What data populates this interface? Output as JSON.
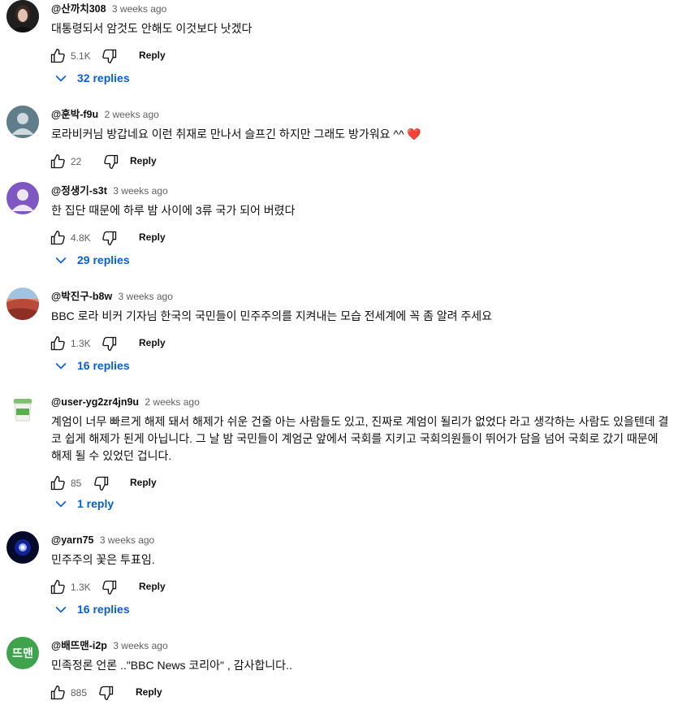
{
  "comments": [
    {
      "author": "@산까치308",
      "time": "3 weeks ago",
      "text": "대통령되서 암것도 안해도 이것보다 낫겠다",
      "likes": "5.1K",
      "reply_label": "Reply",
      "replies_label": "32 replies",
      "avatar": "photo-dark"
    },
    {
      "author": "@훈박-f9u",
      "time": "2 weeks ago",
      "text": "로라비커님 방갑네요 이런 취재로 만나서 슬프긴 하지만 그래도 방가워요 ^^ ❤️",
      "likes": "22",
      "reply_label": "Reply",
      "avatar": "default-gray"
    },
    {
      "author": "@정생기-s3t",
      "time": "3 weeks ago",
      "text": "한 집단 때문에 하루 밤 사이에 3류 국가 되어 버렸다",
      "likes": "4.8K",
      "reply_label": "Reply",
      "replies_label": "29 replies",
      "avatar": "default-purple"
    },
    {
      "author": "@박진구-b8w",
      "time": "3 weeks ago",
      "text": "BBC 로라 비커 기자님 한국의 국민들이 민주주의를 지켜내는 모습 전세계에 꼭 좀 알려 주세요",
      "likes": "1.3K",
      "reply_label": "Reply",
      "replies_label": "16 replies",
      "avatar": "landscape"
    },
    {
      "author": "@user-yg2zr4jn9u",
      "time": "2 weeks ago",
      "text": "계엄이 너무 빠르게 해제 돼서 해제가 쉬운 건줄 아는 사람들도 있고, 진짜로 계엄이 될리가 없었다 라고 생각하는 사람도 있을텐데 결코 쉽게 해제가 된게 아닙니다. 그 날 밤 국민들이 계엄군 앞에서 국회를 지키고 국회의원들이 뛰어가 담을 넘어 국회로 갔기 때문에 해제 될 수 있었던 겁니다.",
      "likes": "85",
      "reply_label": "Reply",
      "replies_label": "1 reply",
      "avatar": "yogurt-cup"
    },
    {
      "author": "@yarn75",
      "time": "3 weeks ago",
      "text": "민주주의 꽃은 투표임.",
      "likes": "1.3K",
      "reply_label": "Reply",
      "replies_label": "16 replies",
      "avatar": "blue-star"
    },
    {
      "author": "@배뜨맨-i2p",
      "time": "3 weeks ago",
      "text": "민족정론 언론 ..\"BBC News 코리아\" , 감사합니다..",
      "likes": "885",
      "reply_label": "Reply",
      "avatar": "text-badge",
      "avatar_text": "뜨맨"
    }
  ],
  "colors": {
    "link_blue": "#065fd4",
    "meta_gray": "#606060",
    "badge_green": "#3fa34d"
  }
}
